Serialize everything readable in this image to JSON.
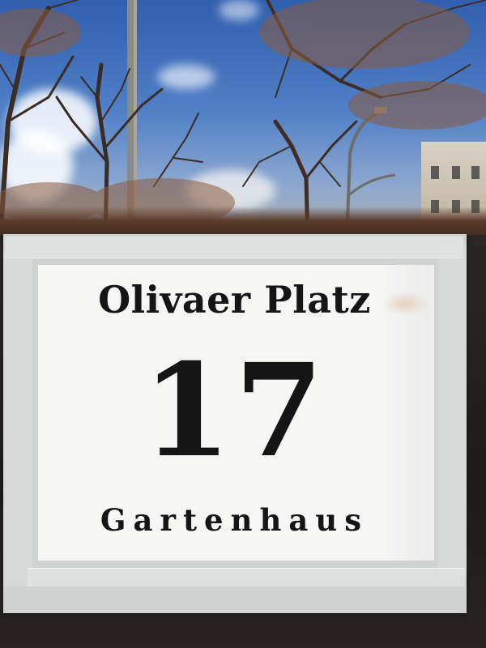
{
  "sign": {
    "street": "Olivaer Platz",
    "number": "17",
    "subtitle": "Gartenhaus"
  },
  "colors": {
    "sky": "#3f6fb8",
    "paper": "#f6f6f5",
    "tape": "#cfd2d1",
    "text": "#151515",
    "window_frame": "#1e1b1a"
  }
}
